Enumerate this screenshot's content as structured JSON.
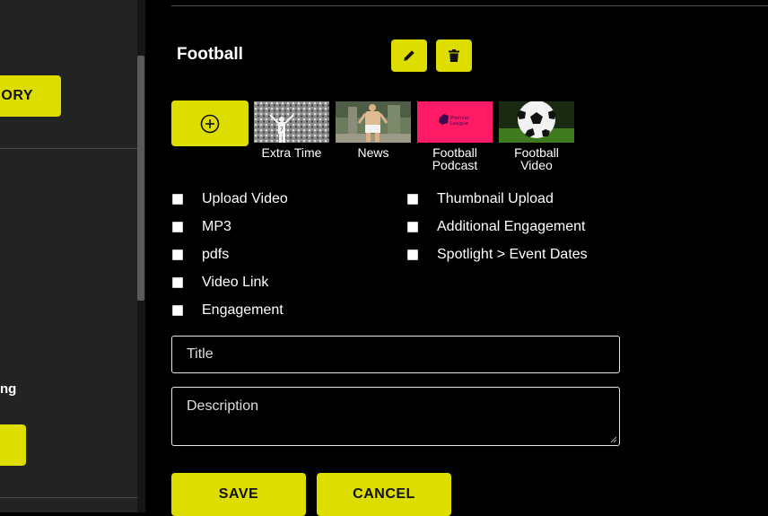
{
  "sidebar": {
    "category_button_label": "GORY",
    "partial_label": "ng"
  },
  "category": {
    "title": "Football",
    "edit_icon": "pencil-icon",
    "delete_icon": "trash-icon"
  },
  "media": {
    "add_icon": "circle-plus-icon",
    "thumbnails": [
      {
        "label_lines": [
          "Extra Time"
        ]
      },
      {
        "label_lines": [
          "News"
        ]
      },
      {
        "label_lines": [
          "Football",
          "Podcast"
        ],
        "logo_text": [
          "Premier",
          "League"
        ]
      },
      {
        "label_lines": [
          "Football",
          "Video"
        ]
      }
    ]
  },
  "options": {
    "left": [
      "Upload Video",
      "MP3",
      "pdfs",
      "Video Link",
      "Engagement"
    ],
    "right": [
      "Thumbnail Upload",
      "Additional Engagement",
      "Spotlight > Event Dates"
    ]
  },
  "form": {
    "title_placeholder": "Title",
    "description_placeholder": "Description"
  },
  "actions": {
    "save_label": "SAVE",
    "cancel_label": "CANCEL"
  },
  "colors": {
    "accent": "#dddd00",
    "background": "#000000",
    "panel": "#232323",
    "podcast_pink": "#ff1a66"
  }
}
